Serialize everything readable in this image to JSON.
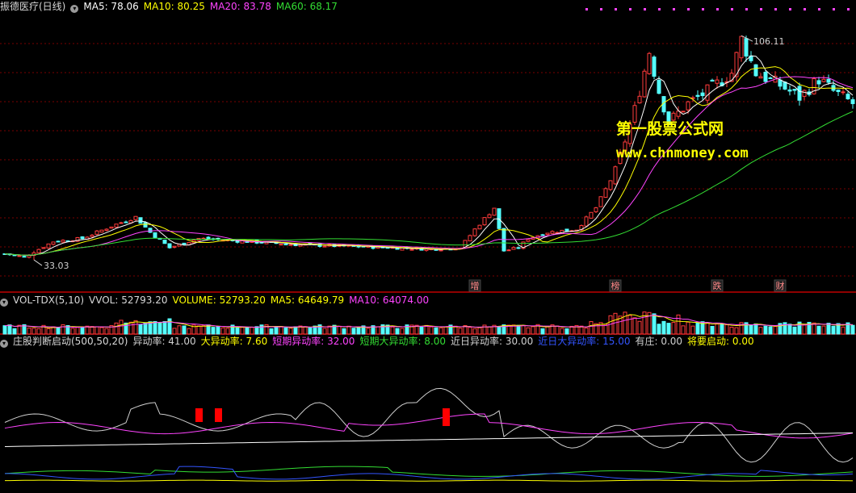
{
  "colors": {
    "ma5": "#ffffff",
    "ma10": "#ffff00",
    "ma20": "#ff44ff",
    "ma60": "#33dd33",
    "up": "#ff3b3b",
    "down": "#55ffff",
    "separator": "#c00000",
    "grid": "#7a0000"
  },
  "main_legend": {
    "title": "振德医疗(日线)",
    "ma5": "MA5: 78.06",
    "ma10": "MA10: 80.25",
    "ma20": "MA20: 83.78",
    "ma60": "MA60: 68.17"
  },
  "vol_legend": {
    "title": "VOL-TDX(5,10)",
    "vvol": "VVOL: 52793.20",
    "volume": "VOLUME: 52793.20",
    "ma5": "MA5: 64649.79",
    "ma10": "MA10: 64074.00"
  },
  "ind_legend": {
    "title": "庄股判断启动(500,50,20)",
    "items": [
      {
        "text": "异动率: 41.00",
        "color": "#d0d0d0"
      },
      {
        "text": "大异动率: 7.60",
        "color": "#ffff00"
      },
      {
        "text": "短期异动率: 32.00",
        "color": "#ff44ff"
      },
      {
        "text": "短期大异动率: 8.00",
        "color": "#33dd33"
      },
      {
        "text": "近日异动率: 30.00",
        "color": "#d0d0d0"
      },
      {
        "text": "近日大异动率: 15.00",
        "color": "#3355ff"
      },
      {
        "text": "有庄: 0.00",
        "color": "#d0d0d0"
      },
      {
        "text": "将要启动: 0.00",
        "color": "#ffff00"
      }
    ]
  },
  "watermark": {
    "line1": "第一股票公式网",
    "line2": "www.chnmoney.com"
  },
  "chart_data": {
    "type": "candlestick",
    "price_range": [
      27,
      113
    ],
    "high_label": "106.11",
    "low_label": "33.03",
    "event_markers": [
      {
        "index": 97,
        "text": "增"
      },
      {
        "index": 126,
        "text": "榜"
      },
      {
        "index": 147,
        "text": "跌"
      },
      {
        "index": 160,
        "text": "财"
      }
    ],
    "volume_range": [
      0,
      260000
    ],
    "indicator_range": [
      0,
      100
    ],
    "indicator_signal_indices": [
      40,
      44,
      91
    ]
  }
}
